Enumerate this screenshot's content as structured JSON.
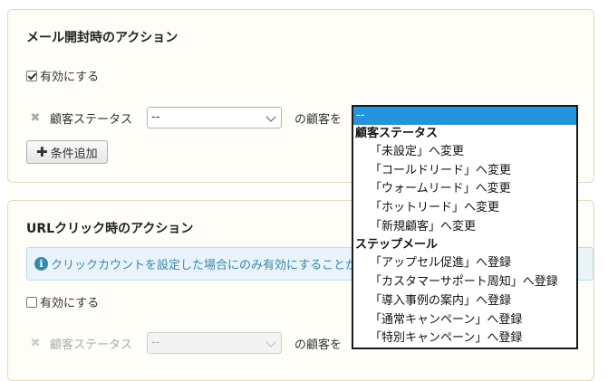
{
  "mail_open": {
    "title": "メール開封時のアクション",
    "enable_label": "有効にする",
    "enabled": true,
    "condition": {
      "label": "顧客ステータス",
      "selected": "--",
      "suffix": "の顧客を"
    },
    "add_condition_label": "条件追加"
  },
  "dropdown": {
    "selected": "--",
    "groups": [
      {
        "label": "顧客ステータス",
        "options": [
          "「未設定」へ変更",
          "「コールドリード」へ変更",
          "「ウォームリード」へ変更",
          "「ホットリード」へ変更",
          "「新規顧客」へ変更"
        ]
      },
      {
        "label": "ステップメール",
        "options": [
          "「アップセル促進」へ登録",
          "「カスタマーサポート周知」へ登録",
          "「導入事例の案内」へ登録",
          "「通常キャンペーン」へ登録",
          "「特別キャンペーン」へ登録"
        ]
      }
    ]
  },
  "url_click": {
    "title": "URLクリック時のアクション",
    "info": "クリックカウントを設定した場合にのみ有効にすることができます。",
    "enable_label": "有効にする",
    "enabled": false,
    "condition": {
      "label": "顧客ステータス",
      "selected": "--",
      "suffix": "の顧客を"
    }
  },
  "colors": {
    "highlight": "#2495dc",
    "info_text": "#3a87ad",
    "panel_border": "#e3d9c0"
  }
}
